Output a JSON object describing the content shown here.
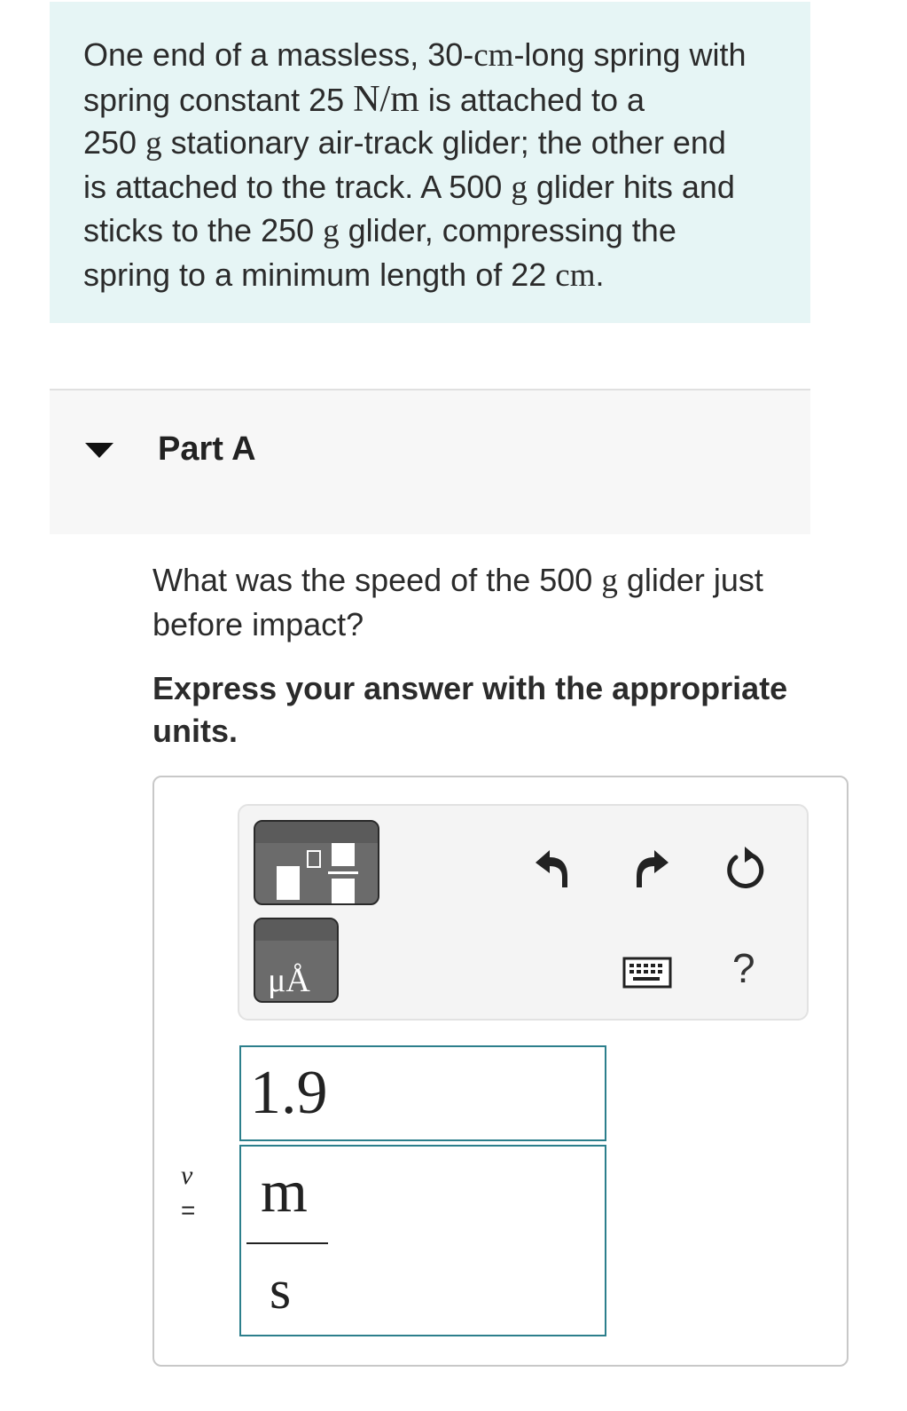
{
  "problem": {
    "l1_a": "One end of a massless, 30-",
    "l1_unit": "cm",
    "l1_b": "-long spring with",
    "l2_a": "spring constant 25 ",
    "l2_unit": "N/m",
    "l2_b": " is attached to a",
    "l3_num": "250 ",
    "l3_unit": "g",
    "l3_b": " stationary air-track glider; the other end",
    "l4_a": "is attached to the track. A 500 ",
    "l4_unit": "g",
    "l4_b": " glider hits and",
    "l5_a": "sticks to the 250 ",
    "l5_unit": "g",
    "l5_b": " glider, compressing the",
    "l6_a": "spring to a minimum length of 22 ",
    "l6_unit": "cm",
    "l6_b": "."
  },
  "part": {
    "title": "Part A",
    "toggle_icon": "caret-down-icon"
  },
  "question": {
    "l1_a": "What was the speed of the 500 ",
    "l1_unit": "g",
    "l1_b": " glider just",
    "l2": "before impact?"
  },
  "instruction": {
    "l1": "Express your answer with the appropriate",
    "l2": "units."
  },
  "toolbar": {
    "units_button_label": "μÅ",
    "icons": [
      "templates-icon",
      "units-icon",
      "undo-icon",
      "redo-icon",
      "reset-icon",
      "keyboard-icon",
      "help-icon"
    ],
    "help_label": "?"
  },
  "answer": {
    "variable": "v",
    "equals": "=",
    "value": "1.9",
    "unit_numerator": "m",
    "unit_denominator": "s"
  },
  "colors": {
    "problem_bg": "#e6f5f5",
    "part_header_bg": "#f7f7f7",
    "field_border": "#2c7f8c",
    "toolbar_button": "#6b6b6b"
  }
}
